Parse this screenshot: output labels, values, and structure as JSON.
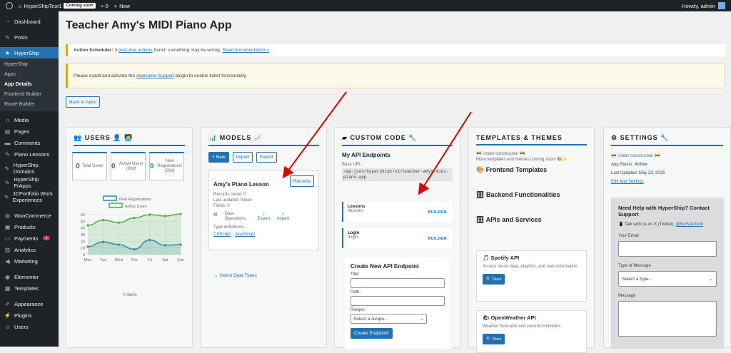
{
  "adminbar": {
    "site_name": "HyperShipTest1",
    "coming_soon": "Coming soon",
    "comments_count": "0",
    "new_label": "New",
    "howdy": "Howdy, admin"
  },
  "sidebar": {
    "items": [
      {
        "label": "Dashboard",
        "icon": "dashboard-icon"
      },
      {
        "label": "Posts",
        "icon": "pin-icon"
      },
      {
        "label": "HyperShip",
        "icon": "star-icon"
      }
    ],
    "submenu": [
      "HyperShip",
      "Apps",
      "App Details",
      "Frontend Builder",
      "Route Builder"
    ],
    "items2": [
      {
        "label": "Media",
        "icon": "media-icon"
      },
      {
        "label": "Pages",
        "icon": "page-icon"
      },
      {
        "label": "Comments",
        "icon": "comment-icon"
      },
      {
        "label": "Piano Lessons",
        "icon": "pin-icon"
      },
      {
        "label": "HyperShip Domains",
        "icon": "pin-icon"
      },
      {
        "label": "HyperShip FrApps",
        "icon": "pin-icon"
      },
      {
        "label": "JCPortfolio Work Experiences",
        "icon": "pin-icon"
      }
    ],
    "items3": [
      {
        "label": "WooCommerce",
        "icon": "woo-icon"
      },
      {
        "label": "Products",
        "icon": "box-icon"
      },
      {
        "label": "Payments",
        "icon": "payment-icon",
        "badge": "1"
      },
      {
        "label": "Analytics",
        "icon": "chart-icon"
      },
      {
        "label": "Marketing",
        "icon": "megaphone-icon"
      }
    ],
    "items4": [
      {
        "label": "Elementor",
        "icon": "elementor-icon"
      },
      {
        "label": "Templates",
        "icon": "folder-icon"
      }
    ],
    "items5": [
      {
        "label": "Appearance",
        "icon": "brush-icon"
      },
      {
        "label": "Plugins",
        "icon": "plug-icon"
      },
      {
        "label": "Users",
        "icon": "user-icon"
      }
    ]
  },
  "page": {
    "title": "Teacher Amy's MIDI Piano App",
    "notice1_prefix": "Action Scheduler:",
    "notice1_count": "3",
    "notice1_link": "past-due actions",
    "notice1_mid": "found; something may be wrong.",
    "notice1_doc": "Read documentation »",
    "notice2_prefix": "Please install and activate the",
    "notice2_link": "Awesome Support",
    "notice2_suffix": "plugin to enable ticket functionality.",
    "back_button": "Back to Apps"
  },
  "users": {
    "title": "USERS",
    "stats": [
      {
        "num": "0",
        "label": "Total Users"
      },
      {
        "num": "0",
        "label": "Active Users (30d)"
      },
      {
        "num": "0",
        "label": "New Registrations (30d)"
      }
    ],
    "items_count": "0 items"
  },
  "chart_data": {
    "type": "line",
    "categories": [
      "Mon",
      "Tue",
      "Wed",
      "Thu",
      "Fri",
      "Sat",
      "Sun"
    ],
    "series": [
      {
        "name": "New Registrations",
        "values": [
          12,
          19,
          15,
          8,
          22,
          14,
          15
        ],
        "color": "#2e86b5"
      },
      {
        "name": "Active Users",
        "values": [
          44,
          52,
          48,
          55,
          60,
          58,
          61
        ],
        "color": "#4caf50"
      }
    ],
    "yticks": [
      "0",
      "10",
      "20",
      "30",
      "40",
      "50",
      "60"
    ],
    "ylim": [
      0,
      60
    ],
    "legend": "top"
  },
  "models": {
    "title": "MODELS",
    "new_btn": "+ New",
    "import_btn": "Import",
    "export_btn": "Export",
    "card": {
      "name": "Amy's Piano Lesson",
      "records_btn": "Records",
      "records_count": "Records count: 0",
      "last_updated": "Last updated: Never",
      "fields": "Fields: 0",
      "ops_label": "Data Operations:",
      "export": "Export",
      "import": "Import",
      "type_defs": "Type definitions..",
      "cdscript": "CDScript",
      "javascript": "JavaScript"
    },
    "select_types": "Select Data Types"
  },
  "custom_code": {
    "title": "CUSTOM CODE",
    "subtitle": "My API Endpoints",
    "base_url_label": "Base URL:",
    "base_url": "/wp-json/hypershipx/v1/teacher-amys-midi-piano-app",
    "endpoints": [
      {
        "name": "Lessons",
        "path": "/lessons",
        "action": "BUILDER"
      },
      {
        "name": "Login",
        "path": "/login",
        "action": "BUILDER"
      }
    ],
    "new_endpoint": {
      "title": "Create New API Endpoint",
      "title_label": "Title:",
      "path_label": "Path:",
      "recipe_label": "Recipe:",
      "recipe_placeholder": "Select a recipe...",
      "create_btn": "Create Endpoint!"
    }
  },
  "templates": {
    "title": "TEMPLATES & THEMES",
    "warn1": "🚧 Under construction 🚧",
    "warn2": "More templates and themes coming soon! 🎨✨",
    "frontend": "Frontend Templates",
    "backend": "Backend Functionalities",
    "apis": "APIs and Services",
    "api_cards": [
      {
        "name": "Spotify API",
        "desc": "Access music data, playlists, and user information",
        "docs": "Docs"
      },
      {
        "name": "OpenWeather API",
        "desc": "Weather forecasts and current conditions",
        "docs": "Docs"
      }
    ]
  },
  "settings": {
    "title": "SETTINGS",
    "warn": "🚧 Under construction 🚧",
    "status_label": "App Status:",
    "status_value": "Active",
    "last_updated": "Last Updated: May 23, 2025",
    "edit_link": "Edit App Settings",
    "help": {
      "title": "Need Help with HyperShip? Contact Support",
      "x_prefix": "Talk with us on X (Twitter):",
      "x_handle": "@NoFateTech",
      "email_label": "Your Email",
      "type_label": "Type of Message",
      "type_placeholder": "Select a type...",
      "message_label": "Message"
    }
  }
}
